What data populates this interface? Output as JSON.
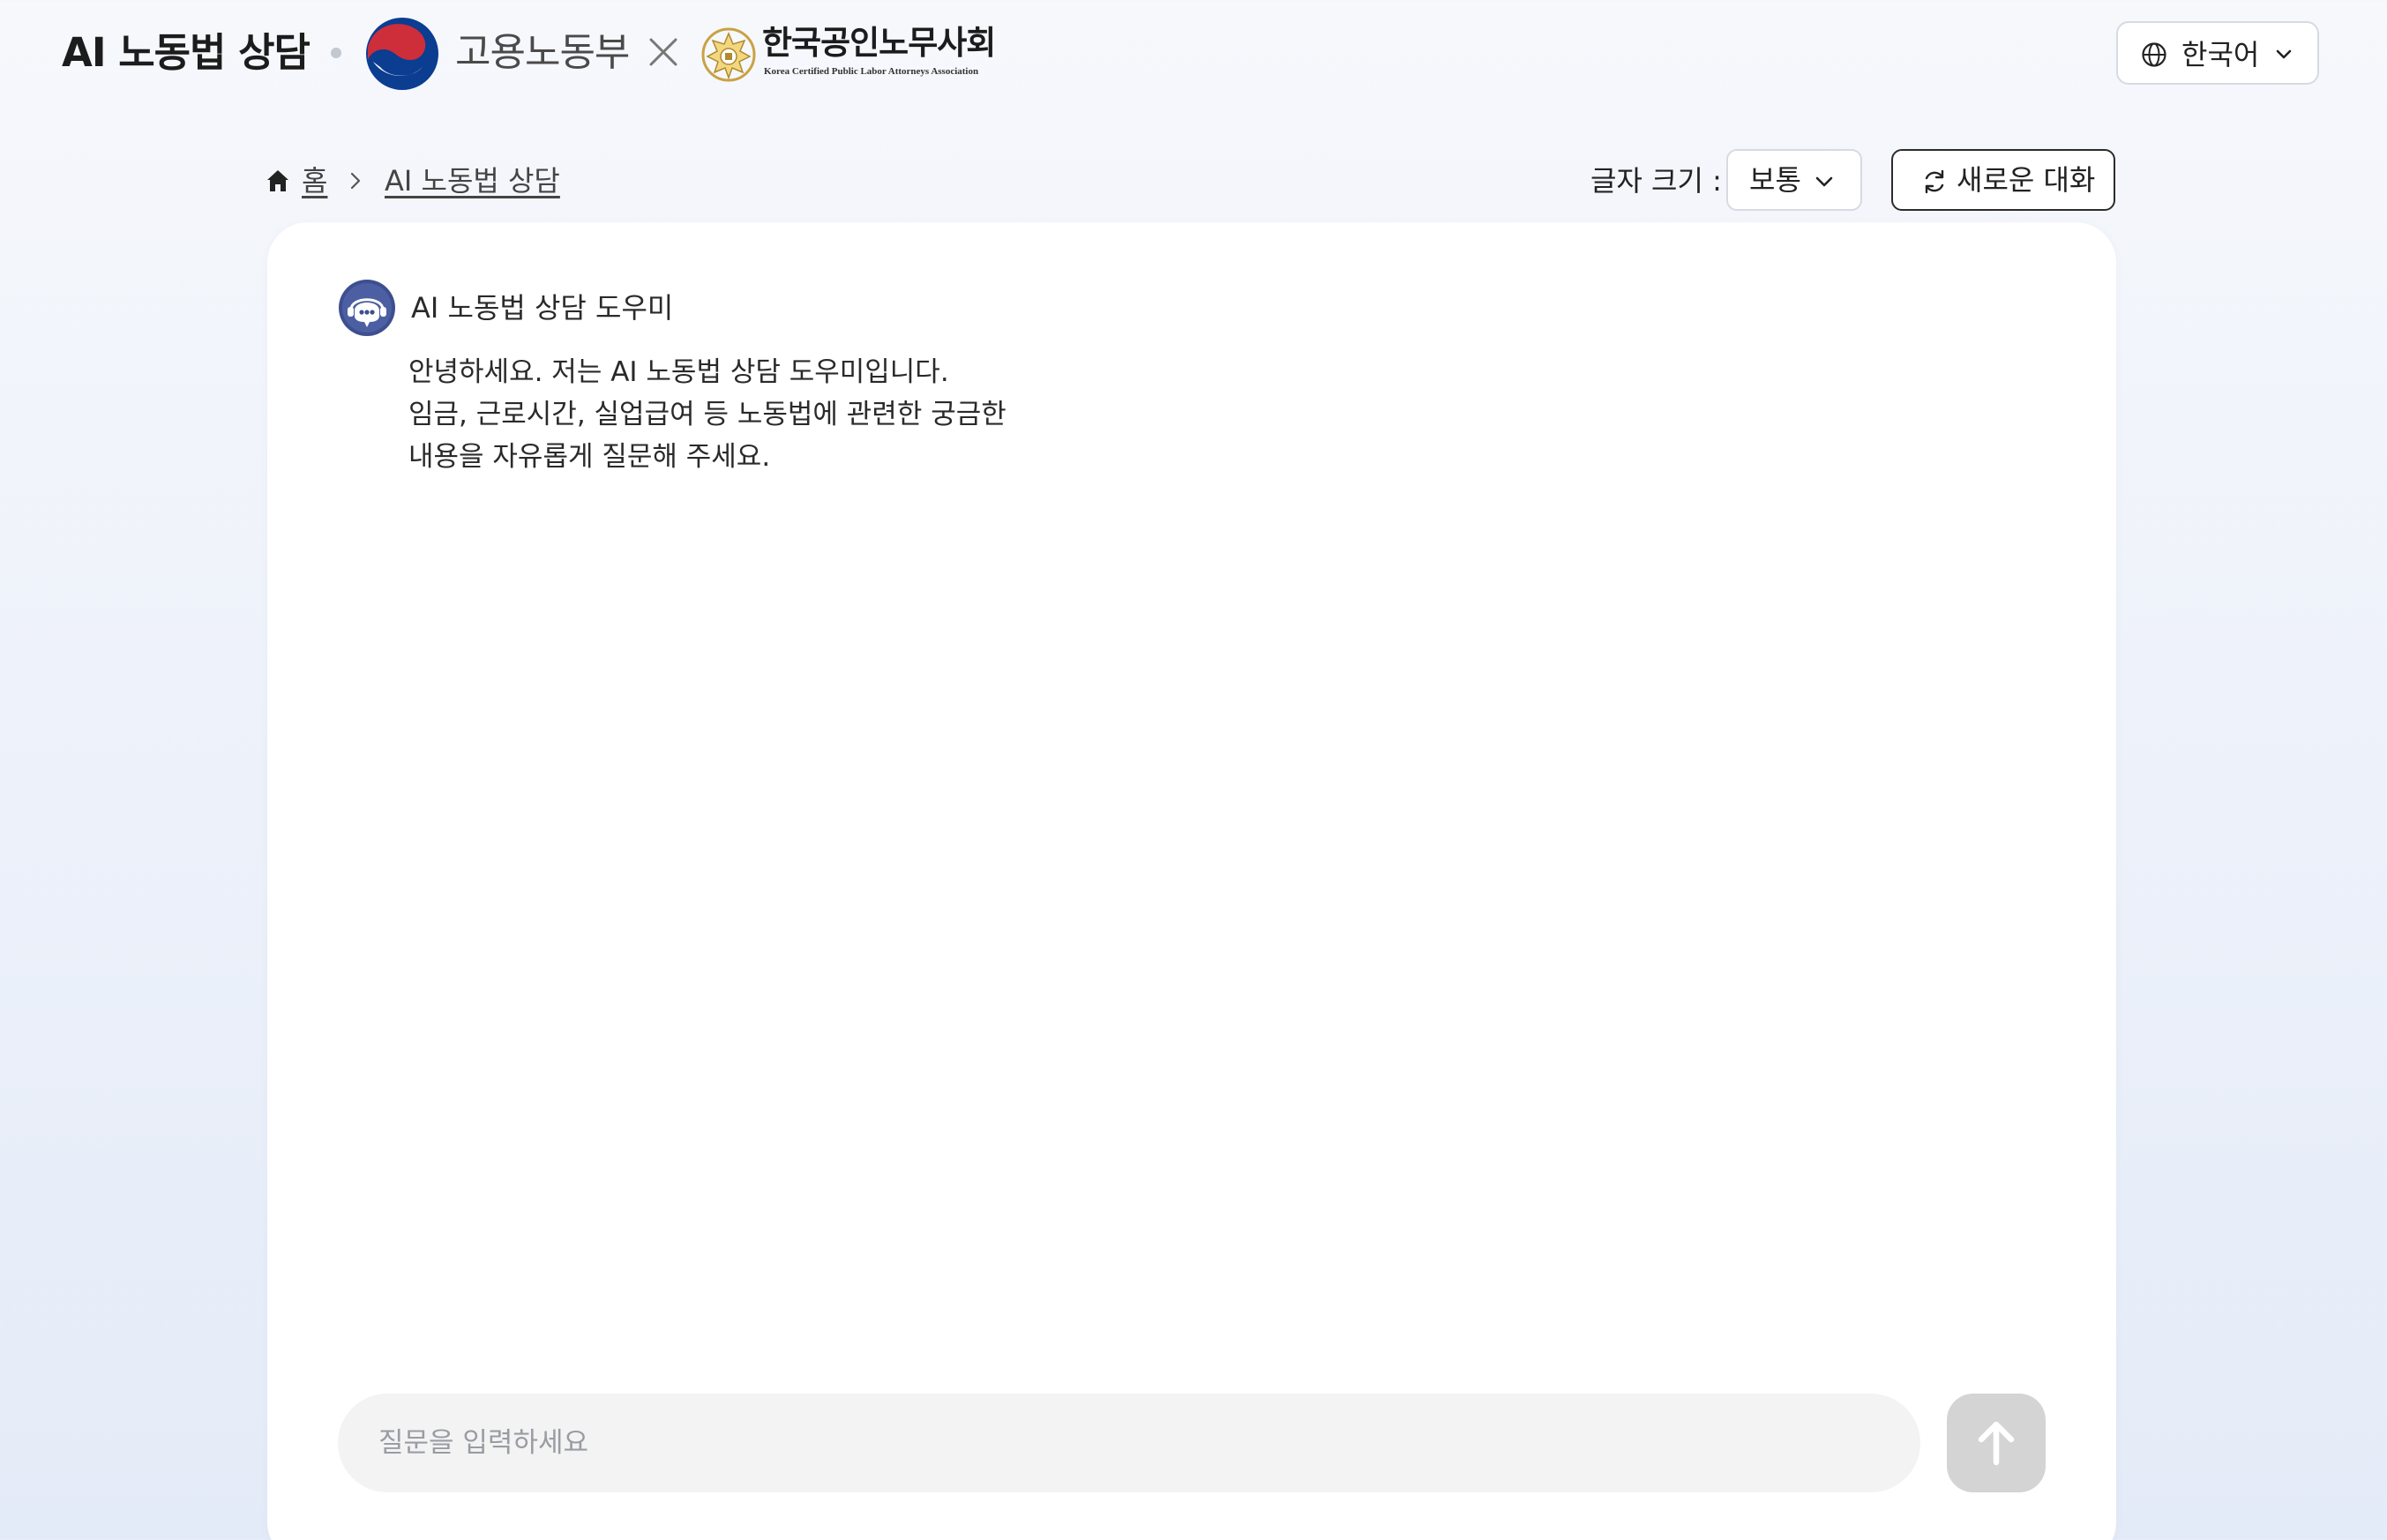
{
  "header": {
    "app_title": "AI 노동법 상담",
    "moel_name": "고용노동부",
    "kcpla_name": "한국공인노무사회",
    "kcpla_subtitle": "Korea Certified Public Labor Attorneys Association",
    "language_label": "한국어"
  },
  "breadcrumb": {
    "home_label": "홈",
    "current_label": "AI 노동법 상담"
  },
  "toolbar": {
    "font_size_label": "글자 크기 :",
    "font_size_value": "보통",
    "new_chat_label": "새로운 대화"
  },
  "chat": {
    "bot_name": "AI 노동법 상담 도우미",
    "messages": [
      {
        "lines": [
          "안녕하세요. 저는 AI 노동법 상담 도우미입니다.",
          "임금, 근로시간, 실업급여 등 노동법에 관련한 궁금한",
          "내용을 자유롭게 질문해 주세요."
        ]
      }
    ],
    "input_value": "",
    "input_placeholder": "질문을 입력하세요"
  },
  "colors": {
    "moel_red": "#cd2e3a",
    "moel_blue": "#0b3d91",
    "send_button": "#d4d4d4",
    "avatar_bg": "#3d4f8f"
  }
}
